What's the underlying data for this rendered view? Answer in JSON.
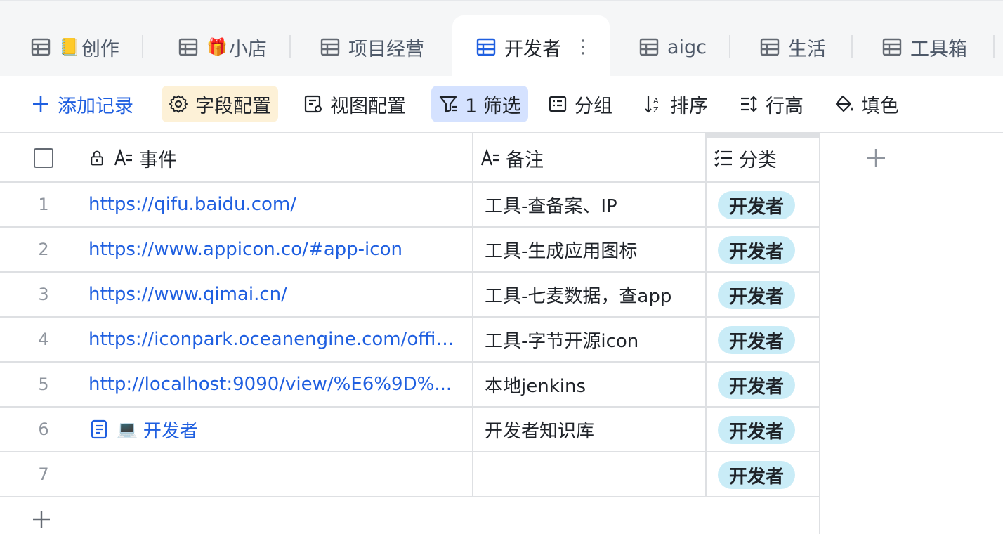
{
  "tabs": [
    {
      "emoji": "📒",
      "label": "创作"
    },
    {
      "emoji": "🎁",
      "label": "小店"
    },
    {
      "emoji": "",
      "label": "项目经营"
    },
    {
      "emoji": "",
      "label": "开发者",
      "more": "⋮"
    },
    {
      "emoji": "",
      "label": "aigc"
    },
    {
      "emoji": "",
      "label": "生活"
    },
    {
      "emoji": "",
      "label": "工具箱"
    }
  ],
  "toolbar": {
    "add_record": "添加记录",
    "field_config": "字段配置",
    "view_config": "视图配置",
    "filter": "1 筛选",
    "group": "分组",
    "sort": "排序",
    "row_height": "行高",
    "fill_color": "填色"
  },
  "columns": {
    "event": "事件",
    "note": "备注",
    "category": "分类"
  },
  "rows": [
    {
      "num": "1",
      "event": "https://qifu.baidu.com/",
      "note": "工具-查备案、IP",
      "category": "开发者"
    },
    {
      "num": "2",
      "event": "https://www.appicon.co/#app-icon",
      "note": "工具-生成应用图标",
      "category": "开发者"
    },
    {
      "num": "3",
      "event": "https://www.qimai.cn/",
      "note": "工具-七麦数据，查app",
      "category": "开发者"
    },
    {
      "num": "4",
      "event": "https://iconpark.oceanengine.com/offic...",
      "note": "工具-字节开源icon",
      "category": "开发者"
    },
    {
      "num": "5",
      "event": "http://localhost:9090/view/%E6%9D%...",
      "note": "本地jenkins",
      "category": "开发者"
    },
    {
      "num": "6",
      "event": "开发者",
      "event_emoji": "💻",
      "note": "开发者知识库",
      "category": "开发者"
    },
    {
      "num": "7",
      "event": "",
      "note": "",
      "category": "开发者"
    }
  ],
  "colors": {
    "accent": "#1f5fe0",
    "tag_bg": "#c9ecf7",
    "filter_bg": "#d5e2ff",
    "field_bg": "#fdf1d7"
  }
}
